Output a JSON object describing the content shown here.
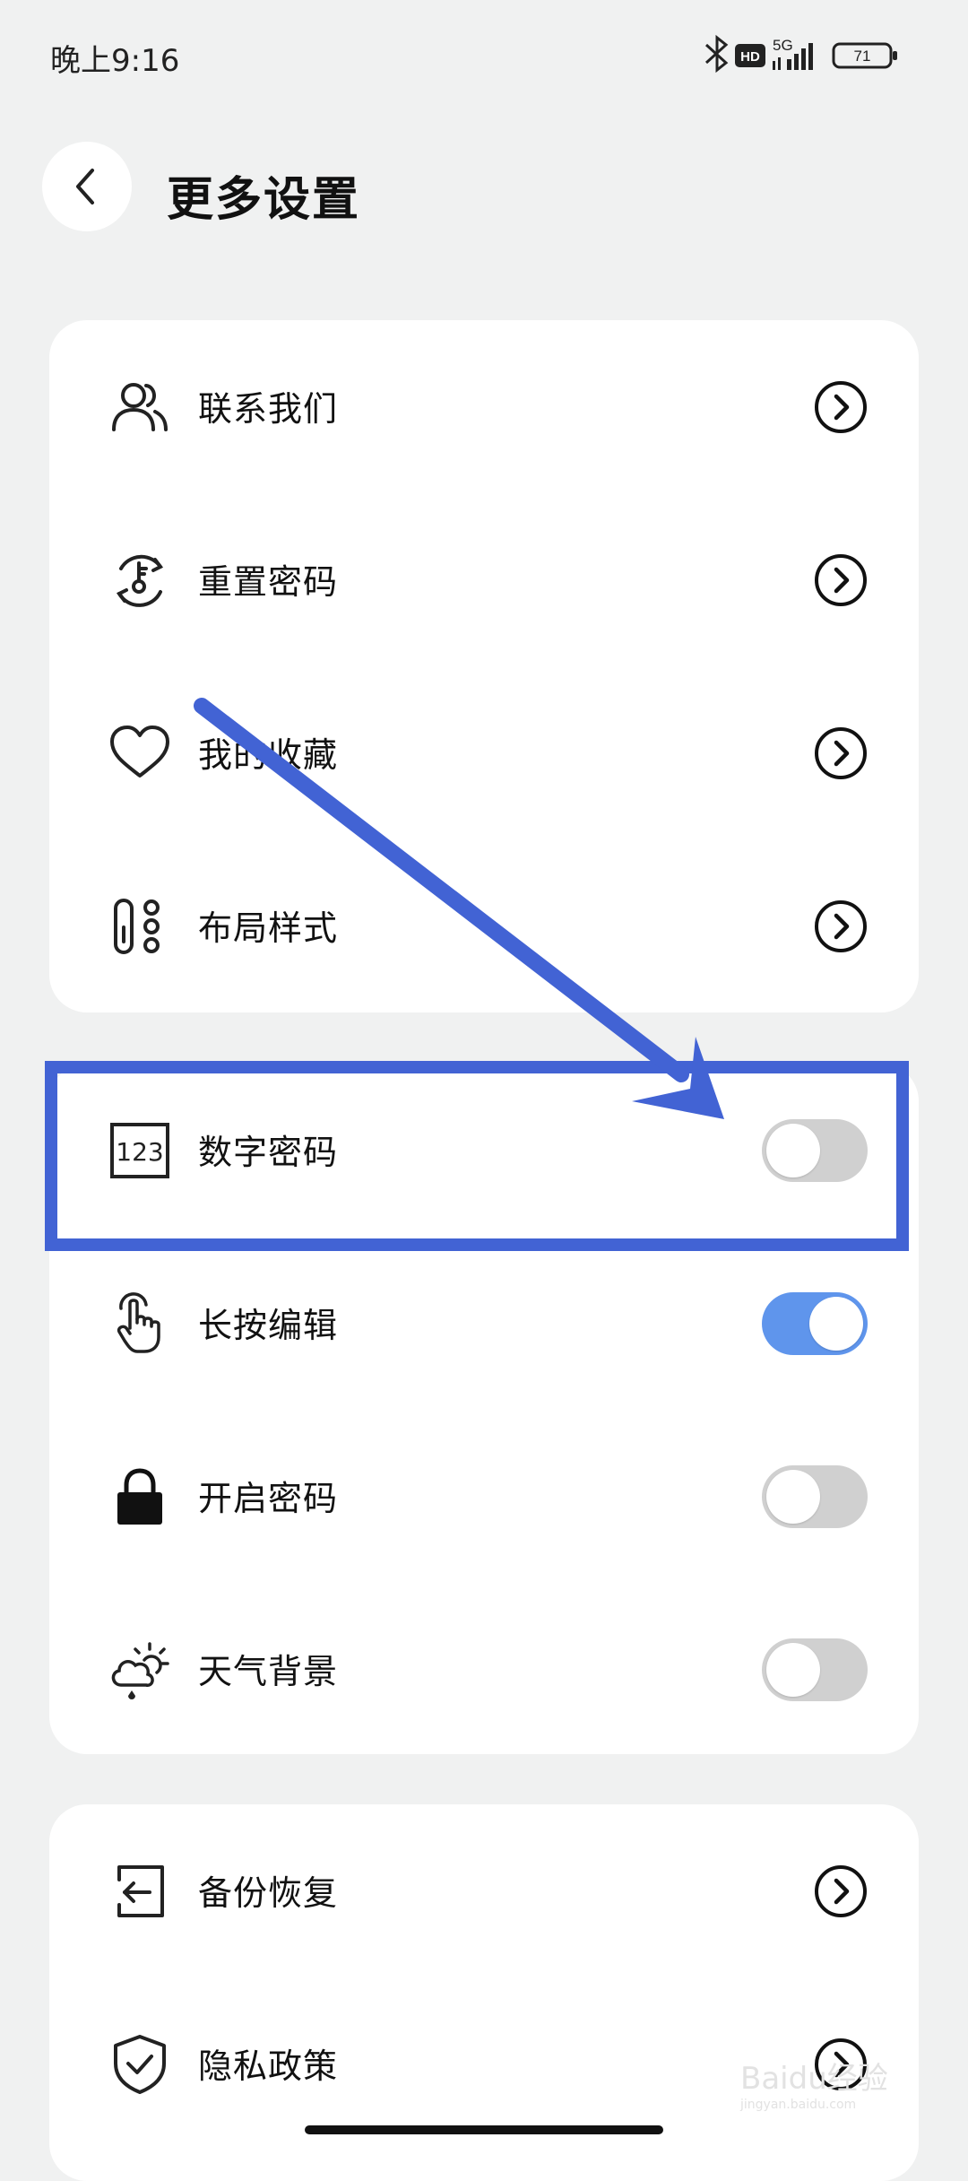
{
  "status_bar": {
    "time": "晚上9:16",
    "network": "5G",
    "hd_badge": "HD",
    "battery": "71",
    "icons": [
      "bluetooth-icon",
      "hd-icon",
      "signal-5g-icon",
      "battery-icon"
    ]
  },
  "header": {
    "back_icon": "chevron-left-icon",
    "title": "更多设置"
  },
  "card1": {
    "items": [
      {
        "label": "联系我们",
        "icon": "contacts-icon",
        "control": "chevron"
      },
      {
        "label": "重置密码",
        "icon": "reset-key-icon",
        "control": "chevron"
      },
      {
        "label": "我的收藏",
        "icon": "heart-icon",
        "control": "chevron"
      },
      {
        "label": "布局样式",
        "icon": "layout-icon",
        "control": "chevron"
      }
    ]
  },
  "card2": {
    "items": [
      {
        "label": "数字密码",
        "icon": "numeric-123-icon",
        "control": "toggle",
        "on": false
      },
      {
        "label": "长按编辑",
        "icon": "touch-hand-icon",
        "control": "toggle",
        "on": true
      },
      {
        "label": "开启密码",
        "icon": "lock-icon",
        "control": "toggle",
        "on": false
      },
      {
        "label": "天气背景",
        "icon": "weather-icon",
        "control": "toggle",
        "on": false
      }
    ]
  },
  "card3": {
    "items": [
      {
        "label": "备份恢复",
        "icon": "backup-restore-icon",
        "control": "chevron"
      },
      {
        "label": "隐私政策",
        "icon": "shield-check-icon",
        "control": "chevron"
      }
    ]
  },
  "watermark": {
    "brand": "Baidu经验",
    "url": "jingyan.baidu.com"
  },
  "colors": {
    "background": "#f0f1f1",
    "toggle_on": "#5f95ec",
    "toggle_off": "#d0d0d0",
    "annotation": "#4263d4"
  }
}
